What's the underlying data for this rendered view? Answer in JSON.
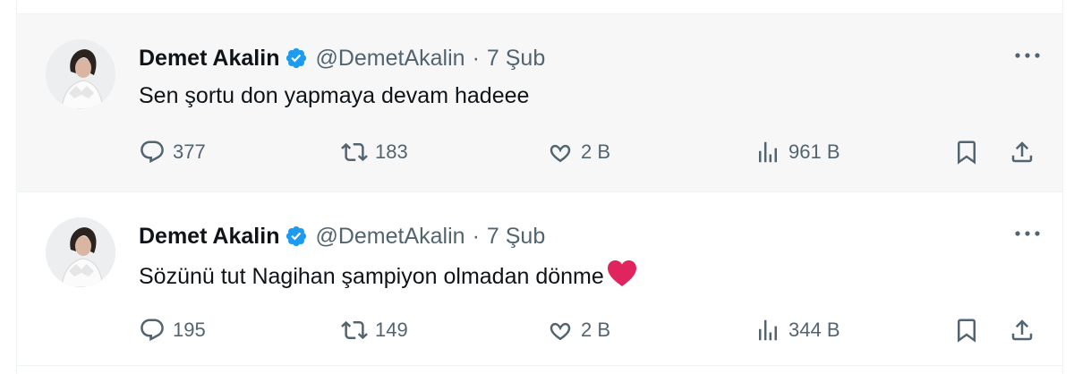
{
  "tweets": [
    {
      "author": {
        "name": "Demet Akalin",
        "handle": "@DemetAkalin",
        "verified": true
      },
      "separator": "·",
      "date": "7 Şub",
      "text": "Sen şortu don yapmaya devam hadeee",
      "emoji": "",
      "stats": {
        "replies": "377",
        "retweets": "183",
        "likes": "2 B",
        "views": "961 B"
      },
      "hovered": true
    },
    {
      "author": {
        "name": "Demet Akalin",
        "handle": "@DemetAkalin",
        "verified": true
      },
      "separator": "·",
      "date": "7 Şub",
      "text": "Sözünü tut Nagihan şampiyon olmadan dönme",
      "emoji": "red-heart",
      "stats": {
        "replies": "195",
        "retweets": "149",
        "likes": "2 B",
        "views": "344 B"
      },
      "hovered": false
    }
  ],
  "colors": {
    "verified": "#1d9bf0",
    "muted_text": "#536471",
    "hover_bg": "#f7f7f7",
    "heart_emoji": "#e0245e"
  },
  "icons": [
    "reply-icon",
    "retweet-icon",
    "like-icon",
    "views-icon",
    "bookmark-icon",
    "share-icon",
    "more-icon",
    "verified-badge-icon"
  ]
}
